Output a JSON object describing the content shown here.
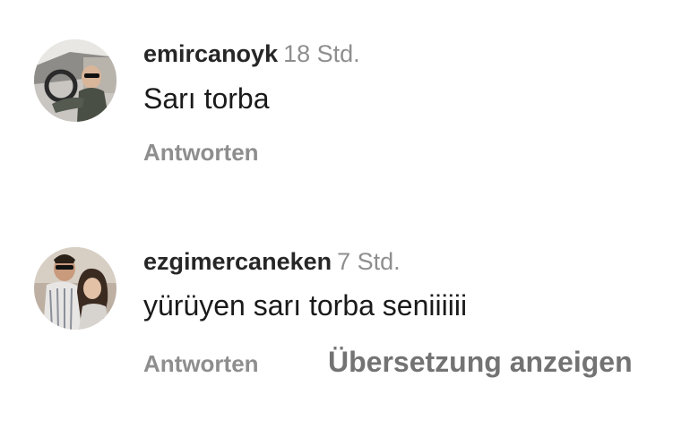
{
  "comments": [
    {
      "username": "emircanoyk",
      "time": "18 Std.",
      "text": "Sarı torba",
      "reply_label": "Antworten",
      "avatar_icon": "profile-photo-man-in-car"
    },
    {
      "username": "ezgimercaneken",
      "time": "7 Std.",
      "text": "yürüyen sarı torba seniiiiii",
      "reply_label": "Antworten",
      "translate_label": "Übersetzung anzeigen",
      "avatar_icon": "profile-photo-couple"
    }
  ]
}
